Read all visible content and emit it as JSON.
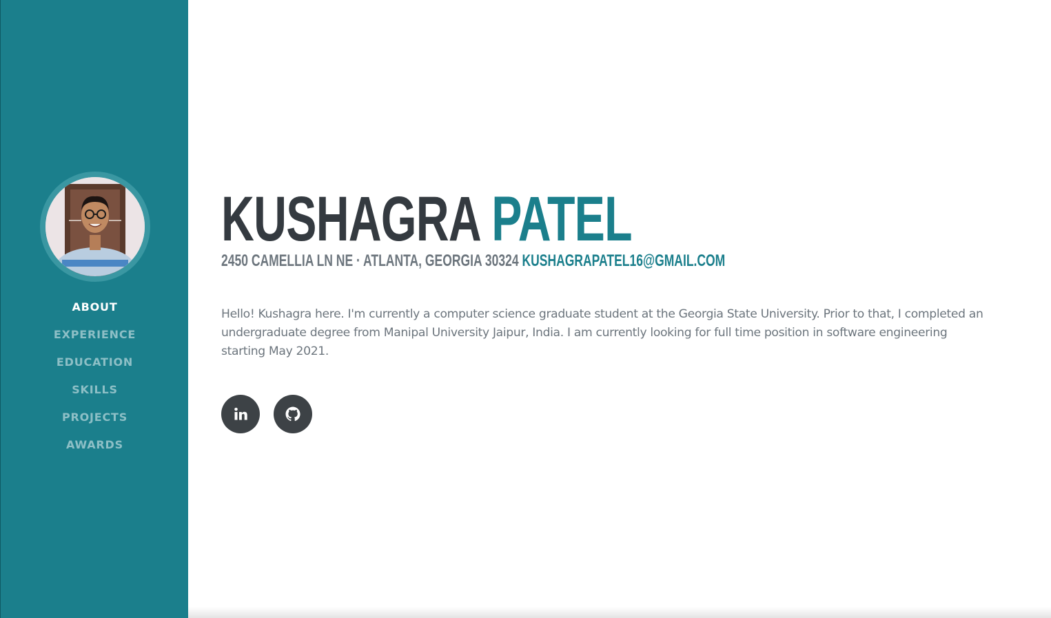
{
  "profile": {
    "photo_alt": "Profile photo",
    "first_name": "KUSHAGRA",
    "last_name": "PATEL",
    "address": "2450 CAMELLIA LN NE · ATLANTA, GEORGIA 30324",
    "email": "KUSHAGRAPATEL16@GMAIL.COM",
    "bio": "Hello! Kushagra here. I'm currently a computer science graduate student at the Georgia State University. Prior to that, I completed an undergraduate degree from Manipal University Jaipur, India. I am currently looking for full time position in software engineering starting May 2021."
  },
  "nav": {
    "items": [
      {
        "label": "ABOUT",
        "active": true
      },
      {
        "label": "EXPERIENCE"
      },
      {
        "label": "EDUCATION"
      },
      {
        "label": "SKILLS"
      },
      {
        "label": "PROJECTS"
      },
      {
        "label": "AWARDS"
      }
    ]
  },
  "social": [
    {
      "icon": "linkedin-icon"
    },
    {
      "icon": "github-icon"
    }
  ],
  "colors": {
    "primary": "#1b7f8c",
    "dark": "#343a40",
    "muted": "#6c757d",
    "social_bg": "#3d4246"
  }
}
